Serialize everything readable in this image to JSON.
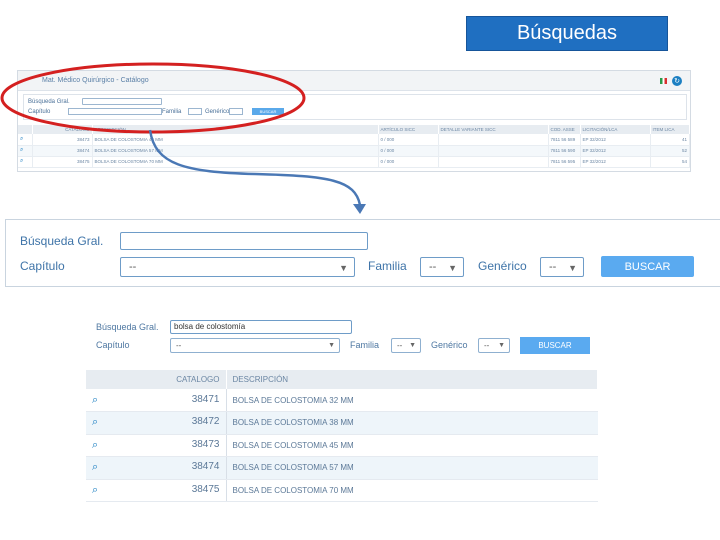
{
  "title": "Búsquedas",
  "mini": {
    "header_title": "Mat. Médico Quirúrgico - Catálogo",
    "labels": {
      "busqueda": "Búsqueda Gral.",
      "capitulo": "Capítulo",
      "familia": "Familia",
      "generico": "Genérico",
      "buscar": "BUSCAR"
    },
    "columns": [
      "",
      "CATALOGO",
      "DESCRIPCIÓN",
      "ARTÍCULO SICC",
      "DETALLE VARIANTE SICC",
      "COD. ASSE",
      "LICITACIÓN/LCA",
      "ITEM LICA"
    ],
    "rows": [
      [
        "38473",
        "BOLSA DE COLOSTOMIA 45 MM",
        "0 / 000",
        "",
        "7811 56 589",
        "EP 32/2012",
        "41"
      ],
      [
        "38474",
        "BOLSA DE COLOSTOMIA 57 MM",
        "0 / 000",
        "",
        "7811 56 590",
        "EP 32/2012",
        "52"
      ],
      [
        "38475",
        "BOLSA DE COLOSTOMIA 70 MM",
        "0 / 000",
        "",
        "7811 56 595",
        "EP 32/2012",
        "54"
      ]
    ]
  },
  "form": {
    "busqueda_label": "Búsqueda Gral.",
    "busqueda_value": "",
    "capitulo_label": "Capítulo",
    "capitulo_value": "--",
    "familia_label": "Familia",
    "familia_value": "--",
    "generico_label": "Genérico",
    "generico_value": "--",
    "buscar_label": "BUSCAR"
  },
  "results": {
    "busqueda_label": "Búsqueda Gral.",
    "busqueda_value": "bolsa de colostomía",
    "capitulo_label": "Capítulo",
    "capitulo_value": "--",
    "familia_label": "Familia",
    "familia_value": "--",
    "generico_label": "Genérico",
    "generico_value": "--",
    "buscar_label": "BUSCAR",
    "col_catalogo": "CATALOGO",
    "col_descripcion": "DESCRIPCIÓN",
    "rows": [
      {
        "catalogo": "38471",
        "descripcion": "BOLSA DE COLOSTOMIA 32 MM"
      },
      {
        "catalogo": "38472",
        "descripcion": "BOLSA DE COLOSTOMIA 38 MM"
      },
      {
        "catalogo": "38473",
        "descripcion": "BOLSA DE COLOSTOMIA 45 MM"
      },
      {
        "catalogo": "38474",
        "descripcion": "BOLSA DE COLOSTOMIA 57 MM"
      },
      {
        "catalogo": "38475",
        "descripcion": "BOLSA DE COLOSTOMIA 70 MM"
      }
    ]
  },
  "icons": {
    "magnifier": "magnifier-icon",
    "refresh": "refresh-icon",
    "flag": "flag-icon",
    "dropdown": "chevron-down-icon"
  },
  "colors": {
    "accent": "#1f6fc1",
    "button": "#5aaaf0",
    "annotation_ellipse": "#d42020",
    "annotation_arrow": "#4a78b5"
  }
}
